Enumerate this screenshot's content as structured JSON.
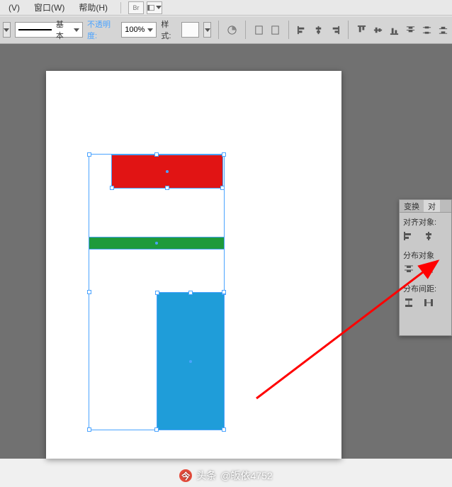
{
  "menu": {
    "items": [
      "(V)",
      "窗口(W)",
      "帮助(H)"
    ],
    "br_label": "Br"
  },
  "toolbar": {
    "stroke_label": "基本",
    "opacity_label": "不透明度:",
    "opacity_value": "100%",
    "style_label": "样式:"
  },
  "panel": {
    "tab_transform": "变换",
    "tab_align": "对",
    "section_align": "对齐对象:",
    "section_distribute": "分布对象",
    "section_spacing": "分布间距:"
  },
  "canvas": {
    "shapes": [
      {
        "id": "red-rect",
        "fill": "#e11414"
      },
      {
        "id": "green-rect",
        "fill": "#1e9a3b"
      },
      {
        "id": "blue-rect",
        "fill": "#1f9dd9"
      }
    ]
  },
  "watermark": {
    "prefix": "头条",
    "handle": "@皈依4752"
  }
}
